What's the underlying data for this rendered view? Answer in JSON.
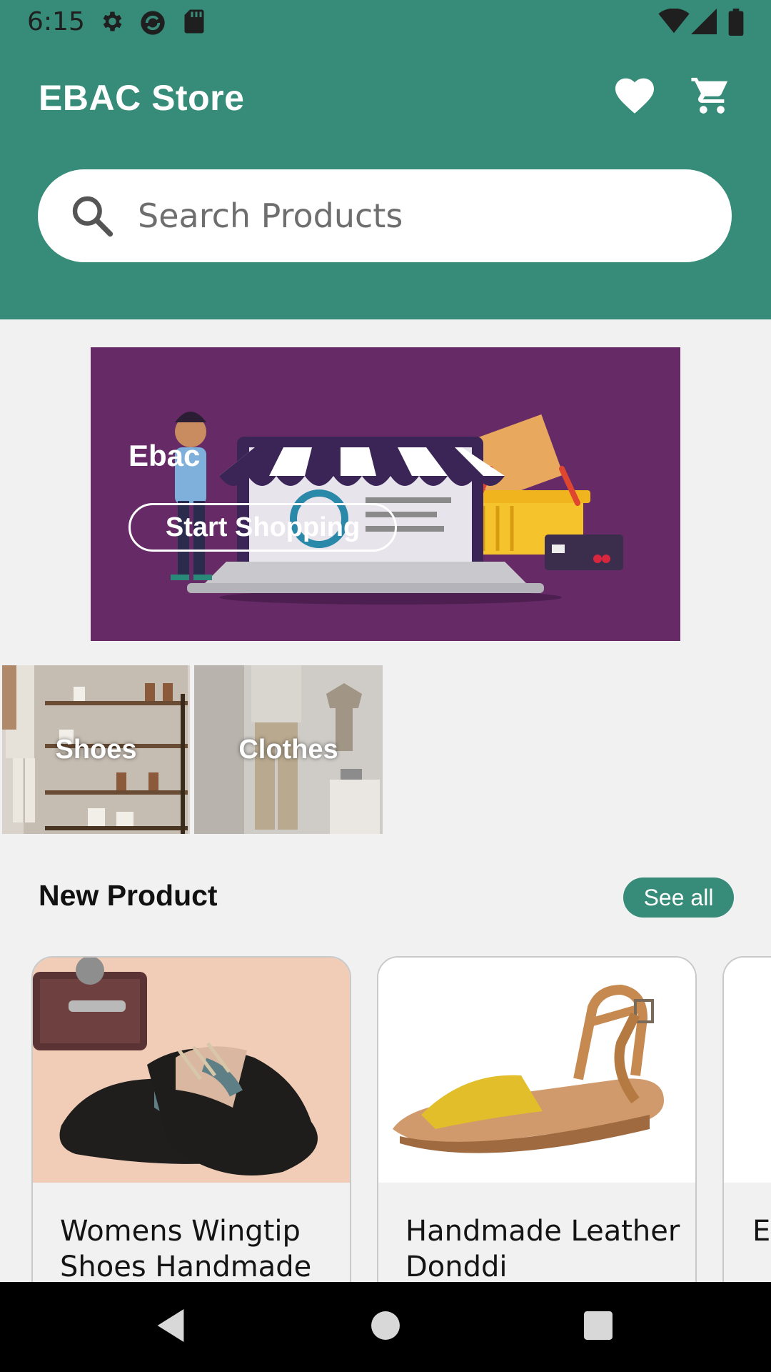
{
  "status_bar": {
    "time": "6:15",
    "icons": [
      "gear-icon",
      "sync-icon",
      "sd-card-icon",
      "wifi-icon",
      "signal-icon",
      "battery-icon"
    ]
  },
  "app_bar": {
    "title": "EBAC Store",
    "icons": [
      "heart-icon",
      "cart-icon"
    ]
  },
  "search": {
    "placeholder": "Search Products"
  },
  "banner": {
    "title": "Ebac",
    "button_label": "Start Shopping"
  },
  "categories": [
    {
      "label": "Shoes"
    },
    {
      "label": "Clothes"
    }
  ],
  "new_products": {
    "title": "New Product",
    "see_all_label": "See all",
    "items": [
      {
        "name": "Womens Wingtip Shoes Handmade"
      },
      {
        "name": "Handmade Leather Donddi"
      },
      {
        "name": "E H"
      }
    ]
  },
  "colors": {
    "primary": "#368c78",
    "banner": "#662b67",
    "background": "#f2f1f1"
  }
}
